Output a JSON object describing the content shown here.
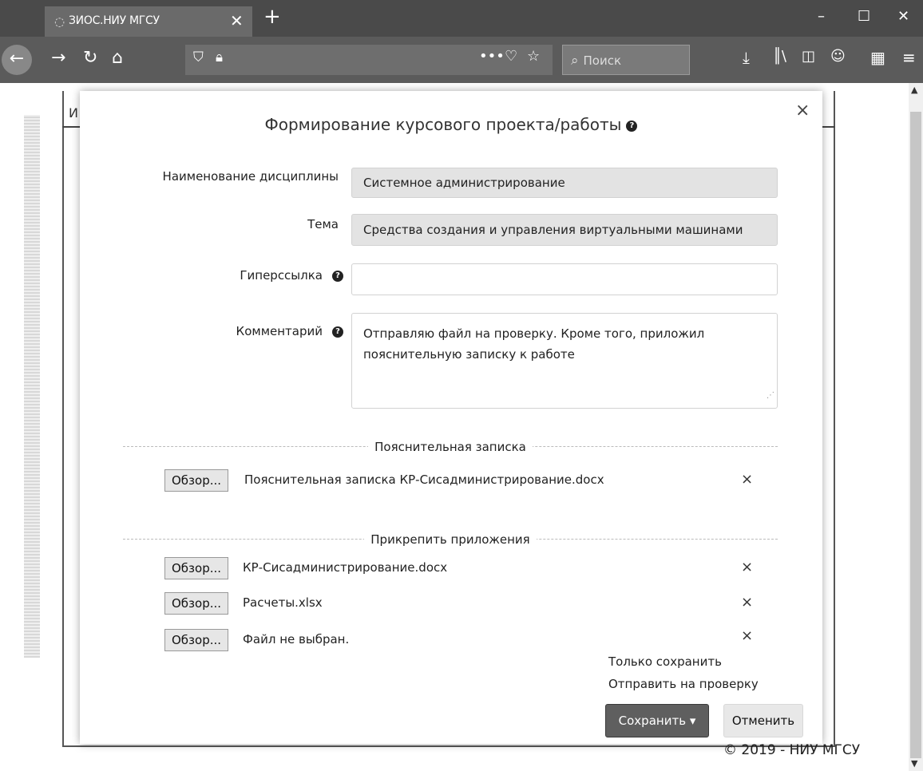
{
  "browser": {
    "tab_title": "ЗИОС.НИУ МГСУ",
    "search_placeholder": "Поиск"
  },
  "page": {
    "truncated_heading": "И",
    "footer": "© 2019 - НИУ МГСУ"
  },
  "modal": {
    "title": "Формирование курсового проекта/работы",
    "fields": {
      "discipline": {
        "label": "Наименование дисциплины",
        "value": "Системное администрирование"
      },
      "topic": {
        "label": "Тема",
        "value": "Средства создания и управления виртуальными машинами"
      },
      "hyperlink": {
        "label": "Гиперссылка",
        "value": ""
      },
      "comment": {
        "label": "Комментарий",
        "value": "Отправляю файл на проверку. Кроме того, приложил пояснительную записку к работе"
      }
    },
    "explanatory_note": {
      "section_title": "Пояснительная записка",
      "browse_label": "Обзор...",
      "file": "Пояснительная записка КР-Сисадминистрирование.docx"
    },
    "attachments": {
      "section_title": "Прикрепить приложения",
      "browse_label": "Обзор...",
      "files": [
        "КР-Сисадминистрирование.docx",
        "Расчеты.xlsx",
        "Файл не выбран."
      ]
    },
    "save_menu": {
      "items": [
        "Только сохранить",
        "Отправить на проверку"
      ]
    },
    "save_button": "Сохранить",
    "cancel_button": "Отменить"
  },
  "icons": {
    "close": "×",
    "remove": "×",
    "help": "?",
    "caret": "▾"
  },
  "colors": {
    "chrome_dark": "#4a4a4a",
    "readonly_field": "#e3e3e3",
    "save_button": "#5f5f5f"
  }
}
